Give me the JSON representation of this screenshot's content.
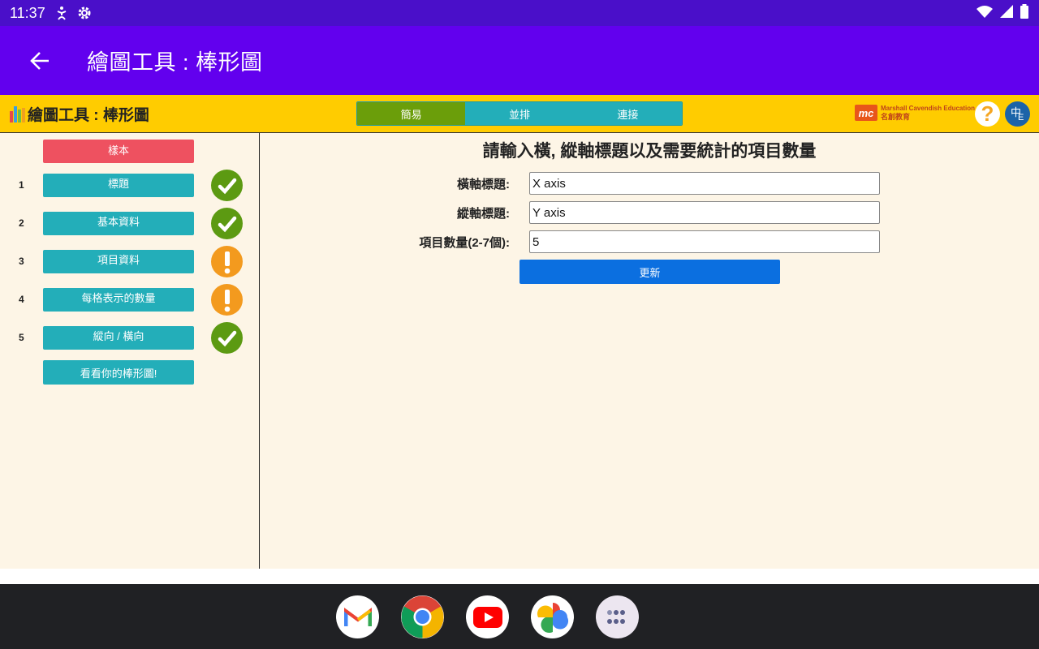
{
  "status_bar": {
    "time": "11:37"
  },
  "app_bar": {
    "title": "繪圖工具 : 棒形圖"
  },
  "web_header": {
    "brand": "繪圖工具 : 棒形圖",
    "tabs": [
      {
        "label": "簡易",
        "active": true
      },
      {
        "label": "並排",
        "active": false
      },
      {
        "label": "連接",
        "active": false
      }
    ],
    "publisher": {
      "mark": "mc",
      "en": "Marshall Cavendish Education",
      "zh": "名創教育"
    },
    "help_label": "?",
    "lang_a": "中",
    "lang_b": "E"
  },
  "sidebar": {
    "sample_label": "樣本",
    "steps": [
      {
        "num": "1",
        "label": "標題",
        "status": "complete"
      },
      {
        "num": "2",
        "label": "基本資料",
        "status": "complete"
      },
      {
        "num": "3",
        "label": "項目資料",
        "status": "incomplete"
      },
      {
        "num": "4",
        "label": "每格表示的數量",
        "status": "incomplete"
      },
      {
        "num": "5",
        "label": "縱向 / 橫向",
        "status": "complete"
      }
    ],
    "view_label": "看看你的棒形圖!"
  },
  "main": {
    "heading": "請輸入橫, 縱軸標題以及需要統計的項目數量",
    "fields": [
      {
        "label": "橫軸標題:",
        "value": "X axis"
      },
      {
        "label": "縱軸標題:",
        "value": "Y axis"
      },
      {
        "label": "項目數量(2-7個):",
        "value": "5"
      }
    ],
    "update_label": "更新"
  },
  "dock": {
    "apps": [
      "gmail-icon",
      "chrome-icon",
      "youtube-icon",
      "photos-icon",
      "app-drawer-icon"
    ]
  },
  "colors": {
    "status_bar": "#4a0fc9",
    "app_bar": "#6200ee",
    "header": "#ffcc00",
    "teal": "#23aeb9",
    "active_tab": "#6b9e0a",
    "sample": "#ee5160",
    "ok": "#5c9a12",
    "warn": "#f39a1e",
    "update": "#0b6fe0",
    "panel_bg": "#fdf5e6"
  }
}
